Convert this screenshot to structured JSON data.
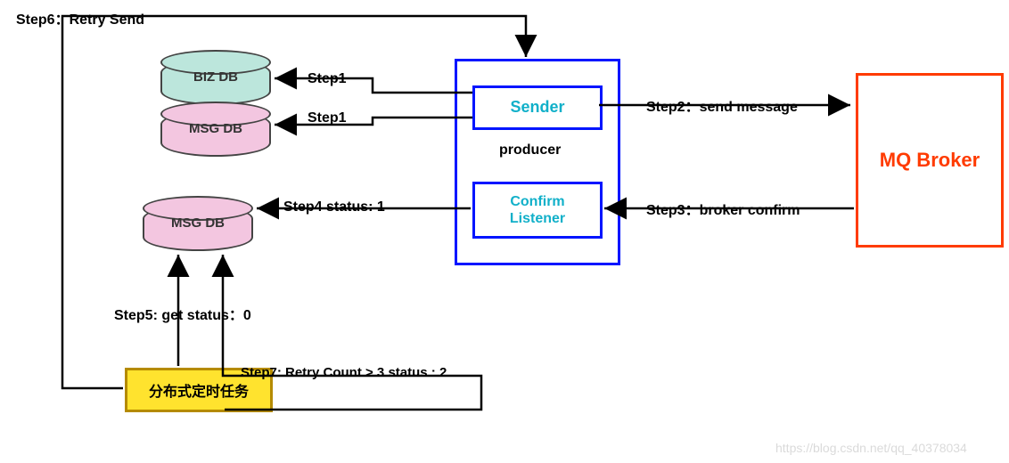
{
  "db": {
    "biz": "BIZ DB",
    "msg1": "MSG DB",
    "msg2": "MSG DB"
  },
  "producer": {
    "sender": "Sender",
    "confirm": "Confirm\nListener",
    "title": "producer"
  },
  "broker": "MQ Broker",
  "job": "分布式定时任务",
  "steps": {
    "s1a": "Step1",
    "s1b": "Step1",
    "s2": "Step2：send message",
    "s3": "Step3：broker confirm",
    "s4": "Step4 status: 1",
    "s5": "Step5: get status：0",
    "s6": "Step6：Retry Send",
    "s7": "Step7: Retry Count > 3 status : 2"
  },
  "watermark": "https://blog.csdn.net/qq_40378034"
}
